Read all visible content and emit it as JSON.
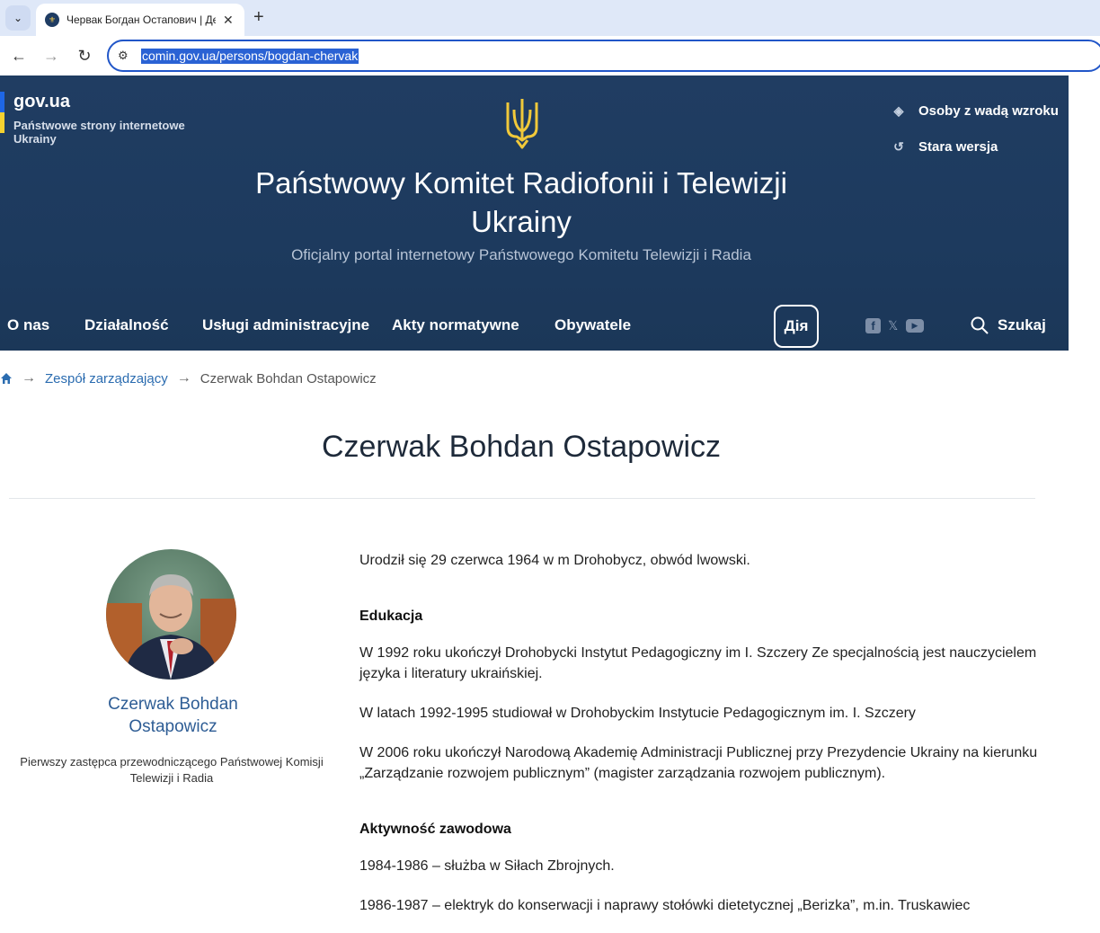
{
  "browser": {
    "tab_title": "Червак Богдан Остапович | Де",
    "url": "comin.gov.ua/persons/bogdan-chervak"
  },
  "header": {
    "gov_logo": "gov.ua",
    "gov_sub": "Państwowe strony internetowe Ukrainy",
    "title": "Państwowy Komitet Radiofonii i Telewizji Ukrainy",
    "subtitle": "Oficjalny portal internetowy Państwowego Komitetu Telewizji i Radia",
    "util_links": [
      "Osoby z wadą wzroku",
      "Stara wersja"
    ],
    "nav": [
      "O nas",
      "Działalność",
      "Usługi administracyjne",
      "Akty normatywne",
      "Obywatele"
    ],
    "dia_label": "Дія",
    "search_label": "Szukaj",
    "colors": {
      "header_bg": "#1d3a5e",
      "accent_yellow": "#f4d130",
      "accent_blue": "#1e66e6"
    }
  },
  "breadcrumb": {
    "link": "Zespół zarządzający",
    "current": "Czerwak Bohdan Ostapowicz"
  },
  "page": {
    "title": "Czerwak Bohdan Ostapowicz",
    "person_name": "Czerwak Bohdan Ostapowicz",
    "person_position": "Pierwszy zastępca przewodniczącego Państwowej Komisji Telewizji i Radia"
  },
  "bio": {
    "born": "Urodził się 29 czerwca 1964 w m Drohobycz, obwód lwowski.",
    "education_heading": "Edukacja",
    "education": [
      "W 1992 roku ukończył Drohobycki Instytut Pedagogiczny im I. Szczery Ze specjalnością jest nauczycielem języka i literatury ukraińskiej.",
      "W latach 1992-1995 studiował w Drohobyckim Instytucie Pedagogicznym im. I. Szczery",
      "W 2006 roku ukończył Narodową Akademię Administracji Publicznej przy Prezydencie Ukrainy na kierunku „Zarządzanie rozwojem publicznym” (magister zarządzania rozwojem publicznym)."
    ],
    "career_heading": "Aktywność zawodowa",
    "career": [
      "1984-1986 – służba w Siłach Zbrojnych.",
      "1986-1987 – elektryk do konserwacji i naprawy stołówki dietetycznej „Berizka”, m.in. Truskawiec"
    ]
  }
}
